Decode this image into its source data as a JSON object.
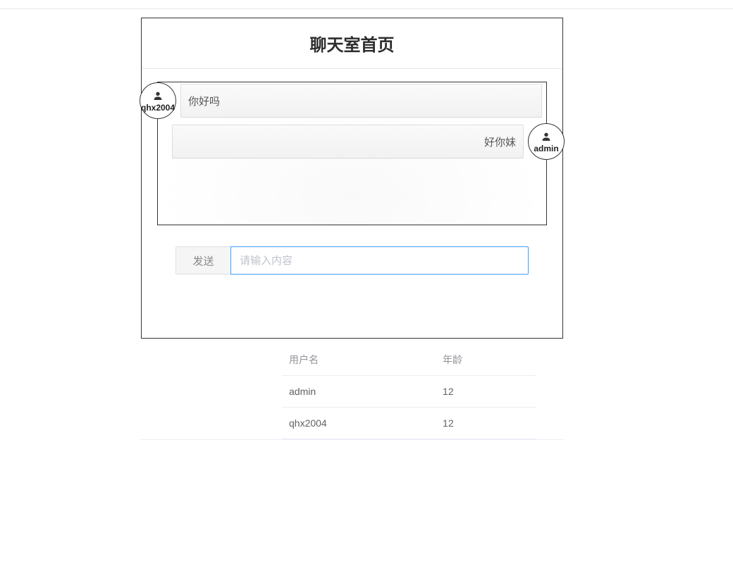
{
  "header": {
    "title": "聊天室首页"
  },
  "chat": {
    "messages": [
      {
        "user": "qhx2004",
        "text": "你好吗",
        "side": "left"
      },
      {
        "user": "admin",
        "text": "好你妹",
        "side": "right"
      }
    ]
  },
  "input": {
    "send_label": "发送",
    "placeholder": "请输入内容",
    "value": ""
  },
  "table": {
    "columns": [
      "用户名",
      "年龄"
    ],
    "rows": [
      {
        "username": "admin",
        "age": "12"
      },
      {
        "username": "qhx2004",
        "age": "12"
      }
    ]
  }
}
